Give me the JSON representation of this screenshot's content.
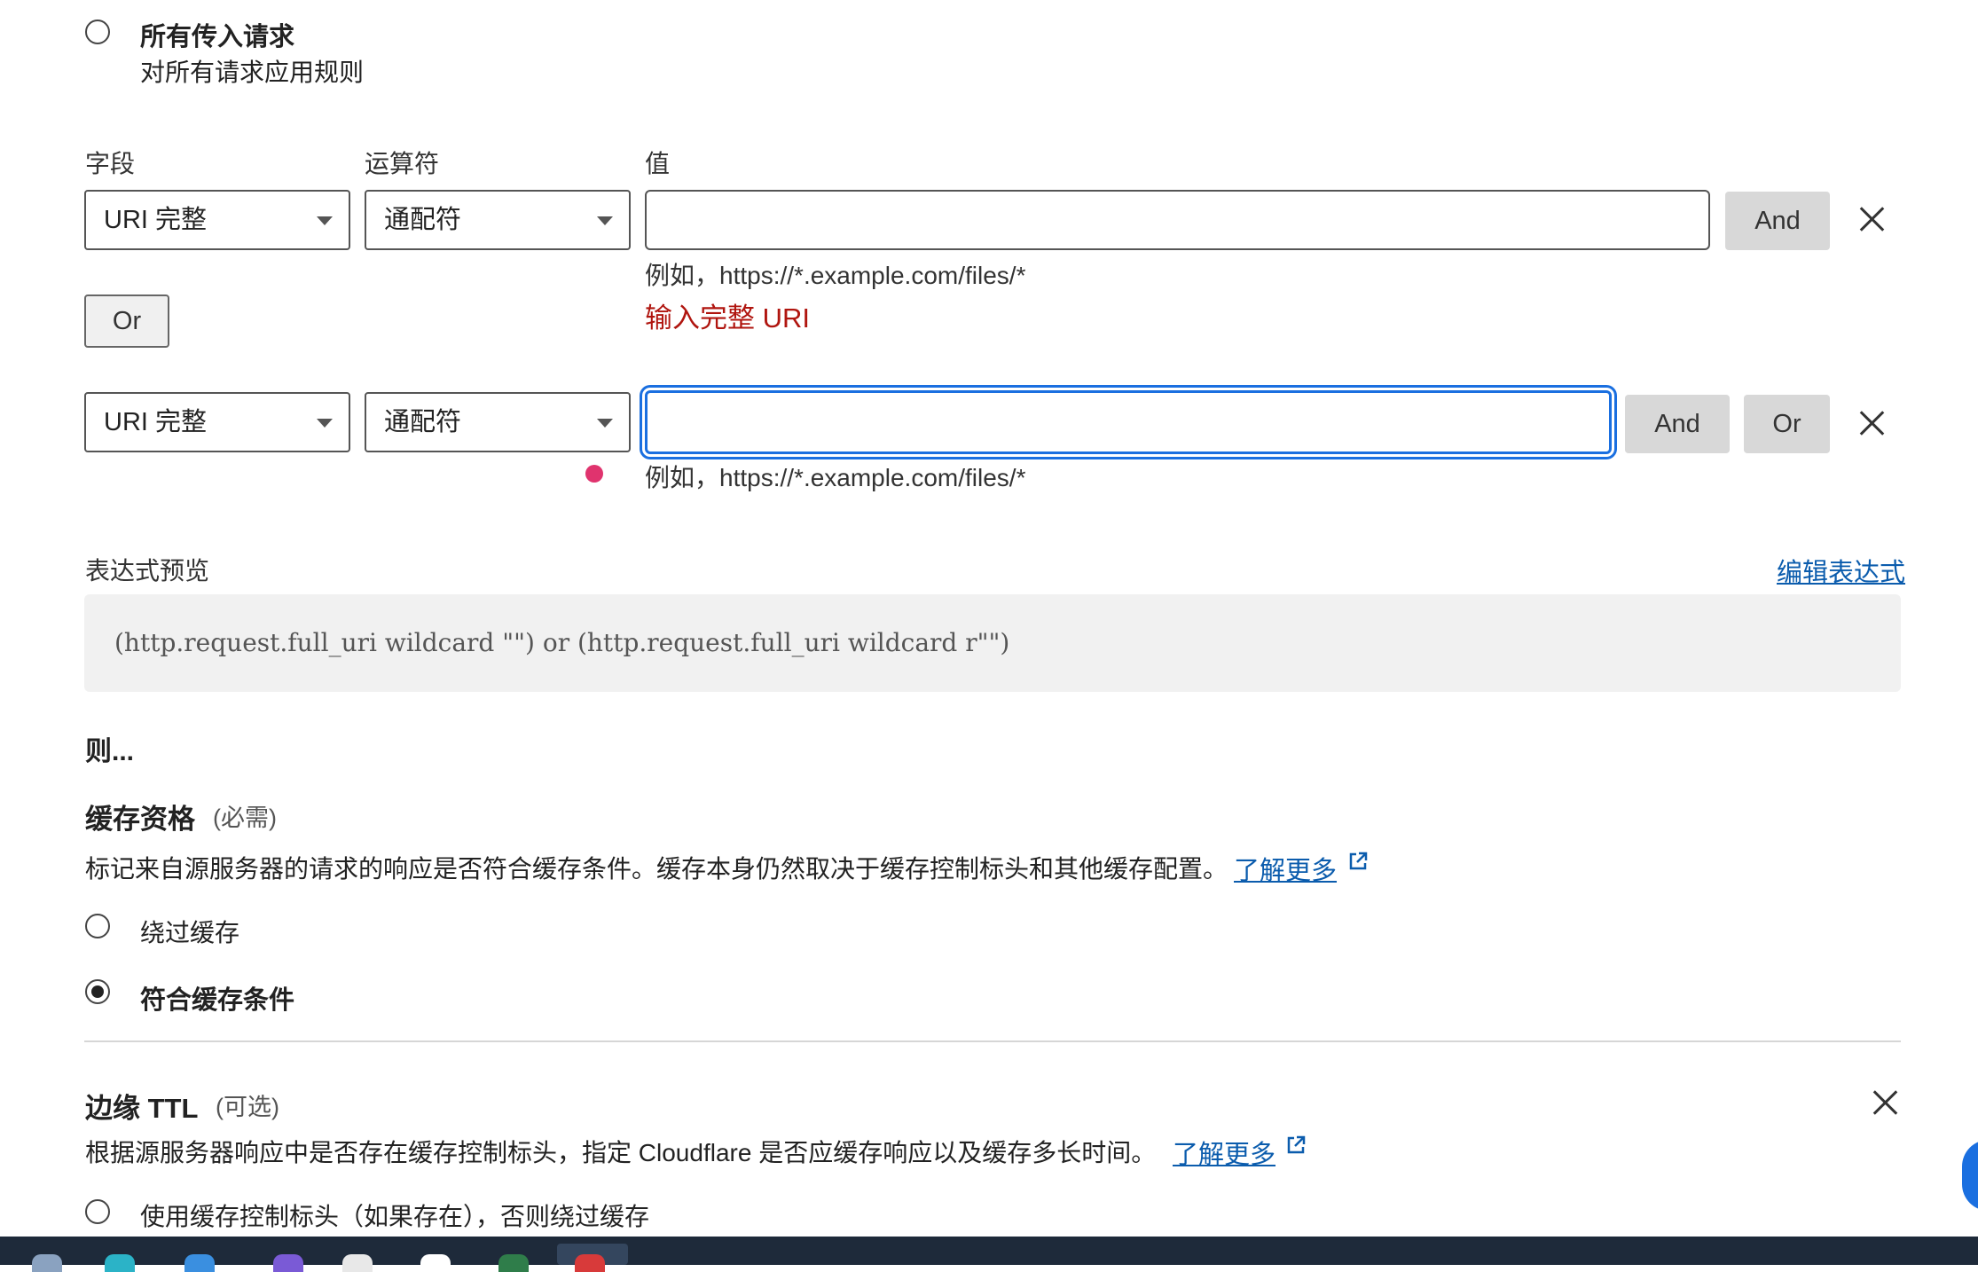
{
  "match_all": {
    "title": "所有传入请求",
    "desc": "对所有请求应用规则"
  },
  "rule_headers": {
    "field": "字段",
    "operator": "运算符",
    "value": "值"
  },
  "rows": [
    {
      "field": "URI 完整",
      "operator": "通配符",
      "value": "",
      "hint": "例如，https://*.example.com/files/*",
      "error": "输入完整 URI",
      "and_label": "And"
    },
    {
      "field": "URI 完整",
      "operator": "通配符",
      "value": "",
      "hint": "例如，https://*.example.com/files/*",
      "and_label": "And",
      "or_label": "Or"
    }
  ],
  "or_group_label": "Or",
  "expression": {
    "label": "表达式预览",
    "edit_link": "编辑表达式",
    "code": "(http.request.full_uri wildcard \"\") or (http.request.full_uri wildcard r\"\")"
  },
  "then": {
    "heading": "则...",
    "cache_eligibility": {
      "title": "缓存资格",
      "required": "(必需)",
      "desc": "标记来自源服务器的请求的响应是否符合缓存条件。缓存本身仍然取决于缓存控制标头和其他缓存配置。",
      "learn_more": "了解更多",
      "options": [
        {
          "label": "绕过缓存",
          "checked": false
        },
        {
          "label": "符合缓存条件",
          "checked": true
        }
      ]
    },
    "edge_ttl": {
      "title": "边缘 TTL",
      "optional": "(可选)",
      "desc": "根据源服务器响应中是否存在缓存控制标头，指定 Cloudflare 是否应缓存响应以及缓存多长时间。",
      "learn_more": "了解更多",
      "options": [
        {
          "label": "使用缓存控制标头（如果存在），否则绕过缓存",
          "checked": false
        }
      ]
    }
  },
  "colors": {
    "link": "#0b5cad",
    "error": "#b0150f",
    "focus": "#1a6fe0",
    "dot": "#e0336e"
  }
}
